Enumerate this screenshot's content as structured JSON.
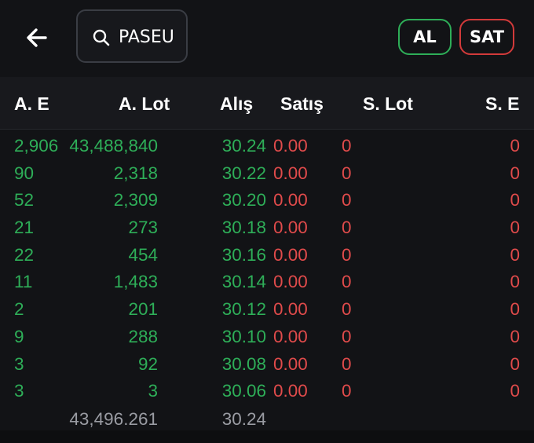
{
  "header": {
    "search_value": "PASEU",
    "buy_label": "AL",
    "sell_label": "SAT"
  },
  "columns": [
    "A. E",
    "A. Lot",
    "Alış",
    "Satış",
    "S. Lot",
    "S. E"
  ],
  "rows": [
    {
      "ae": "2,906",
      "alot": "43,488,840",
      "alis": "30.24",
      "satis": "0.00",
      "slot": "0",
      "se": "0"
    },
    {
      "ae": "90",
      "alot": "2,318",
      "alis": "30.22",
      "satis": "0.00",
      "slot": "0",
      "se": "0"
    },
    {
      "ae": "52",
      "alot": "2,309",
      "alis": "30.20",
      "satis": "0.00",
      "slot": "0",
      "se": "0"
    },
    {
      "ae": "21",
      "alot": "273",
      "alis": "30.18",
      "satis": "0.00",
      "slot": "0",
      "se": "0"
    },
    {
      "ae": "22",
      "alot": "454",
      "alis": "30.16",
      "satis": "0.00",
      "slot": "0",
      "se": "0"
    },
    {
      "ae": "11",
      "alot": "1,483",
      "alis": "30.14",
      "satis": "0.00",
      "slot": "0",
      "se": "0"
    },
    {
      "ae": "2",
      "alot": "201",
      "alis": "30.12",
      "satis": "0.00",
      "slot": "0",
      "se": "0"
    },
    {
      "ae": "9",
      "alot": "288",
      "alis": "30.10",
      "satis": "0.00",
      "slot": "0",
      "se": "0"
    },
    {
      "ae": "3",
      "alot": "92",
      "alis": "30.08",
      "satis": "0.00",
      "slot": "0",
      "se": "0"
    },
    {
      "ae": "3",
      "alot": "3",
      "alis": "30.06",
      "satis": "0.00",
      "slot": "0",
      "se": "0"
    }
  ],
  "totals": {
    "alot": "43,496.261",
    "alis": "30.24"
  },
  "icons": {
    "back": "arrow-left-icon",
    "search": "search-icon"
  },
  "colors": {
    "buy": "#2eae58",
    "sell": "#e04b4b",
    "background": "#121316"
  }
}
